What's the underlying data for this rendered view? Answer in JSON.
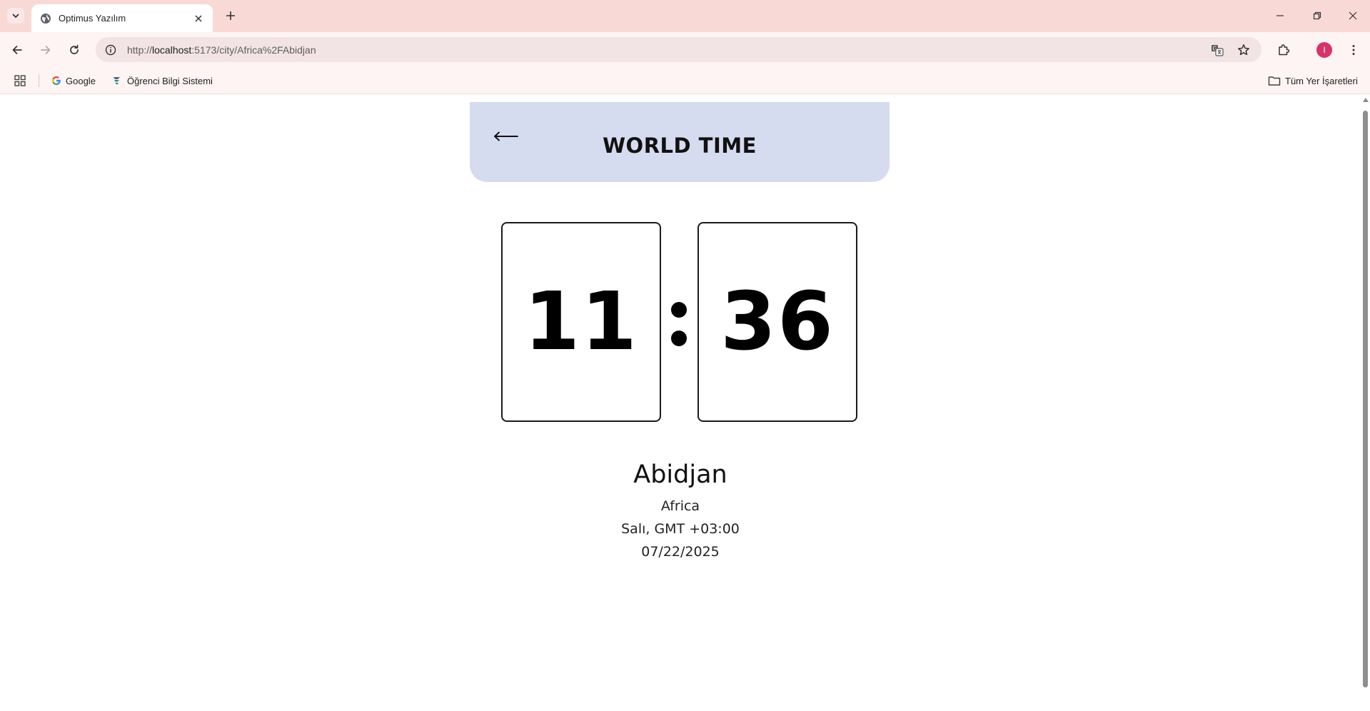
{
  "browser": {
    "tab": {
      "title": "Optimus Yazılım"
    },
    "address_bar": {
      "url_prefix": "http://",
      "url_host": "localhost",
      "url_rest": ":5173/city/Africa%2FAbidjan"
    },
    "bookmarks": [
      {
        "label": "Google"
      },
      {
        "label": "Öğrenci Bilgi Sistemi"
      }
    ],
    "all_bookmarks_label": "Tüm Yer İşaretleri",
    "profile_initial": "I"
  },
  "page": {
    "header": {
      "back_icon": "left-arrow",
      "title": "WORLD TIME"
    },
    "clock": {
      "hours": "11",
      "separator": ":",
      "minutes": "36"
    },
    "location": {
      "city": "Abidjan",
      "region": "Africa",
      "day_offset": "Salı, GMT +03:00",
      "date": "07/22/2025"
    }
  },
  "colors": {
    "header_bg": "#d5dcef",
    "tabstrip_bg": "#f9d9d6",
    "toolbar_bg": "#fdf4f3",
    "avatar": "#d6336c"
  }
}
